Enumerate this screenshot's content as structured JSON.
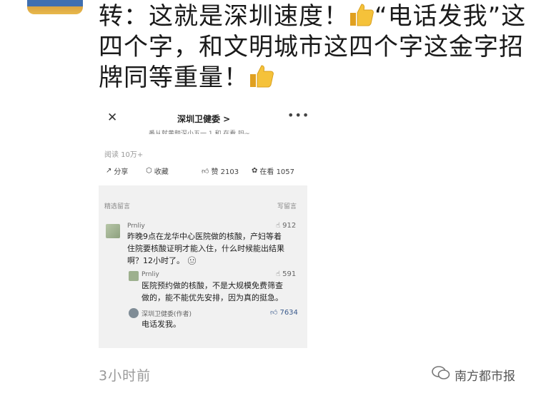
{
  "post": {
    "text_part1": "转：这就是深圳速度！",
    "text_part2": "“电话发我”这四个字，和文明城市这四个字这金字招牌同等重量！",
    "thumb_icon": "thumbs-up-emoji",
    "time": "3小时前"
  },
  "screenshot": {
    "nav_title": "深圳卫健委 >",
    "close_icon": "close-icon",
    "more_label": "•••",
    "cut_text": "番从就黄颜深小五一 1   和 在看 吗~",
    "reads": "阅读 10万+",
    "share_label": "分享",
    "collect_label": "收藏",
    "like_label": "赞 2103",
    "looking_label": "在看 1057",
    "selected_comments": "精选留言",
    "write_comment": "写留言",
    "comments": [
      {
        "user": "Prnliy",
        "likes": "912",
        "line1": "昨晚9点在龙华中心医院做的核酸，产妇等着",
        "line2": "住院要核酸证明才能入住，什么时候能出结果",
        "line3": "啊？12小时了。"
      }
    ],
    "replies": [
      {
        "user": "Prnliy",
        "likes": "591",
        "line1": "医院预约做的核酸，不是大规模免费筛查",
        "line2": "做的，能不能优先安排，因为真的挺急。"
      },
      {
        "user": "深圳卫健委(作者)",
        "likes": "7634",
        "line1": "电话发我。"
      }
    ]
  },
  "watermark": "南方都市报",
  "colors": {
    "gray_bg": "#f1f1f1",
    "accent_like": "#3a5a8c"
  }
}
